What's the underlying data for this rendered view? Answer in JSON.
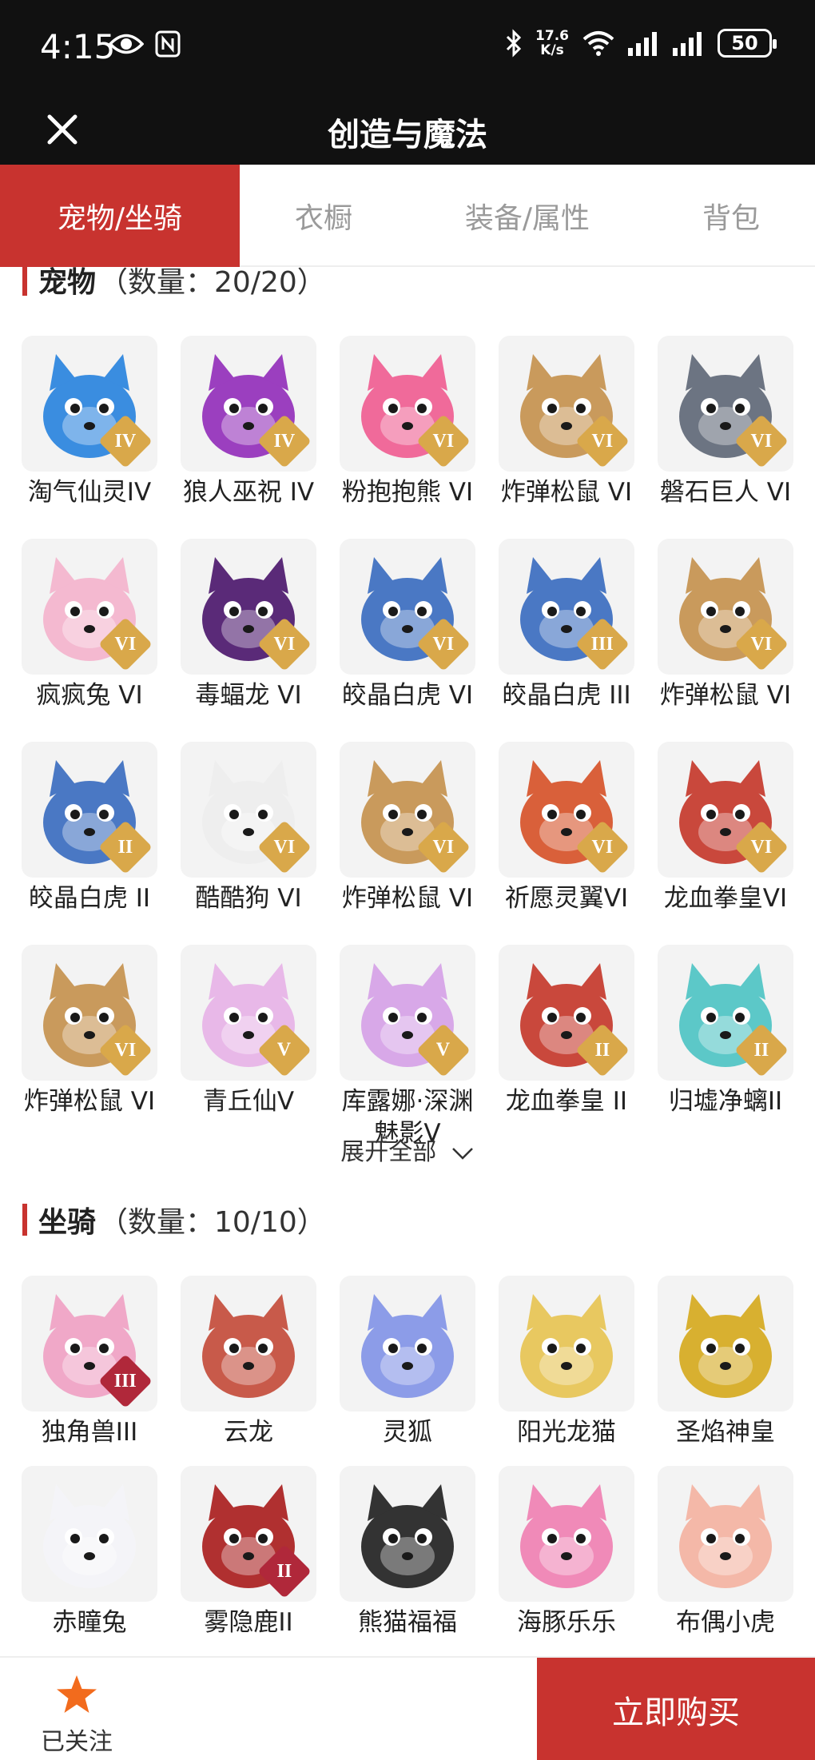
{
  "status_bar": {
    "time": "4:15",
    "net_speed_top": "17.6",
    "net_speed_bottom": "K/s",
    "battery": "50"
  },
  "header": {
    "title": "创造与魔法"
  },
  "tabs": [
    {
      "label": "宠物/坐骑",
      "active": true
    },
    {
      "label": "衣橱",
      "active": false
    },
    {
      "label": "装备/属性",
      "active": false
    },
    {
      "label": "背包",
      "active": false
    }
  ],
  "pets": {
    "title": "宠物",
    "count": "（数量：20/20）",
    "items": [
      {
        "name": "淘气仙灵IV",
        "badge": "IV",
        "icon": "blue-fairy-pet-icon",
        "color": "#3a8de0"
      },
      {
        "name": "狼人巫祝 IV",
        "badge": "IV",
        "icon": "werewolf-shaman-icon",
        "color": "#9b3fbf"
      },
      {
        "name": "粉抱抱熊 VI",
        "badge": "VI",
        "icon": "pink-bear-icon",
        "color": "#f06a9a"
      },
      {
        "name": "炸弹松鼠 VI",
        "badge": "VI",
        "icon": "bomb-squirrel-icon",
        "color": "#c99a5c"
      },
      {
        "name": "磐石巨人 VI",
        "badge": "VI",
        "icon": "rock-giant-icon",
        "color": "#6c7482"
      },
      {
        "name": "疯疯兔 VI",
        "badge": "VI",
        "icon": "crazy-rabbit-icon",
        "color": "#f4b9d0"
      },
      {
        "name": "毒蝠龙 VI",
        "badge": "VI",
        "icon": "venom-bat-dragon-icon",
        "color": "#5a2a78"
      },
      {
        "name": "皎晶白虎 VI",
        "badge": "VI",
        "icon": "white-tiger-icon",
        "color": "#4a78c4"
      },
      {
        "name": "皎晶白虎 III",
        "badge": "III",
        "icon": "white-tiger-icon",
        "color": "#4a78c4"
      },
      {
        "name": "炸弹松鼠 VI",
        "badge": "VI",
        "icon": "bomb-squirrel-icon",
        "color": "#c99a5c"
      },
      {
        "name": "皎晶白虎 II",
        "badge": "II",
        "icon": "white-tiger-icon",
        "color": "#4a78c4"
      },
      {
        "name": "酷酷狗 VI",
        "badge": "VI",
        "icon": "cool-dog-icon",
        "color": "#eeeeee"
      },
      {
        "name": "炸弹松鼠 VI",
        "badge": "VI",
        "icon": "bomb-squirrel-icon",
        "color": "#c99a5c"
      },
      {
        "name": "祈愿灵翼VI",
        "badge": "VI",
        "icon": "wish-wing-bird-icon",
        "color": "#d9603a"
      },
      {
        "name": "龙血拳皇VI",
        "badge": "VI",
        "icon": "dragon-blood-boxer-icon",
        "color": "#c9483c"
      },
      {
        "name": "炸弹松鼠 VI",
        "badge": "VI",
        "icon": "bomb-squirrel-icon",
        "color": "#c99a5c"
      },
      {
        "name": "青丘仙V",
        "badge": "V",
        "icon": "fox-fairy-icon",
        "color": "#e8b8e8"
      },
      {
        "name": "库露娜·深渊魅影V",
        "badge": "V",
        "icon": "kuluna-abyss-icon",
        "color": "#d8a8e8"
      },
      {
        "name": "龙血拳皇 II",
        "badge": "II",
        "icon": "dragon-blood-boxer-icon",
        "color": "#c9483c"
      },
      {
        "name": "归墟净螭II",
        "badge": "II",
        "icon": "sea-dragon-icon",
        "color": "#5cc8c8"
      }
    ],
    "expand_label": "展开全部"
  },
  "mounts": {
    "title": "坐骑",
    "count": "（数量：10/10）",
    "items": [
      {
        "name": "独角兽III",
        "badge": "III",
        "icon": "unicorn-icon",
        "color": "#f0a8c8"
      },
      {
        "name": "云龙",
        "badge": "",
        "icon": "cloud-dragon-icon",
        "color": "#c85a4a"
      },
      {
        "name": "灵狐",
        "badge": "",
        "icon": "spirit-fox-icon",
        "color": "#8c9ce8"
      },
      {
        "name": "阳光龙猫",
        "badge": "",
        "icon": "sunny-totoro-icon",
        "color": "#e8c860"
      },
      {
        "name": "圣焰神皇",
        "badge": "",
        "icon": "holy-flame-phoenix-icon",
        "color": "#d8b030"
      },
      {
        "name": "赤瞳兔",
        "badge": "",
        "icon": "red-eye-rabbit-icon",
        "color": "#f4f4f8"
      },
      {
        "name": "雾隐鹿II",
        "badge": "II",
        "icon": "mist-deer-icon",
        "color": "#b03030"
      },
      {
        "name": "熊猫福福",
        "badge": "",
        "icon": "panda-icon",
        "color": "#333333"
      },
      {
        "name": "海豚乐乐",
        "badge": "",
        "icon": "dolphin-icon",
        "color": "#f08ab8"
      },
      {
        "name": "布偶小虎",
        "badge": "",
        "icon": "rag-doll-tiger-icon",
        "color": "#f4b8a8"
      }
    ]
  },
  "bottom_bar": {
    "follow_label": "已关注",
    "buy_label": "立即购买"
  },
  "colors": {
    "accent": "#c8332f",
    "star": "#f26b1d",
    "badge": "#d9a84a"
  }
}
